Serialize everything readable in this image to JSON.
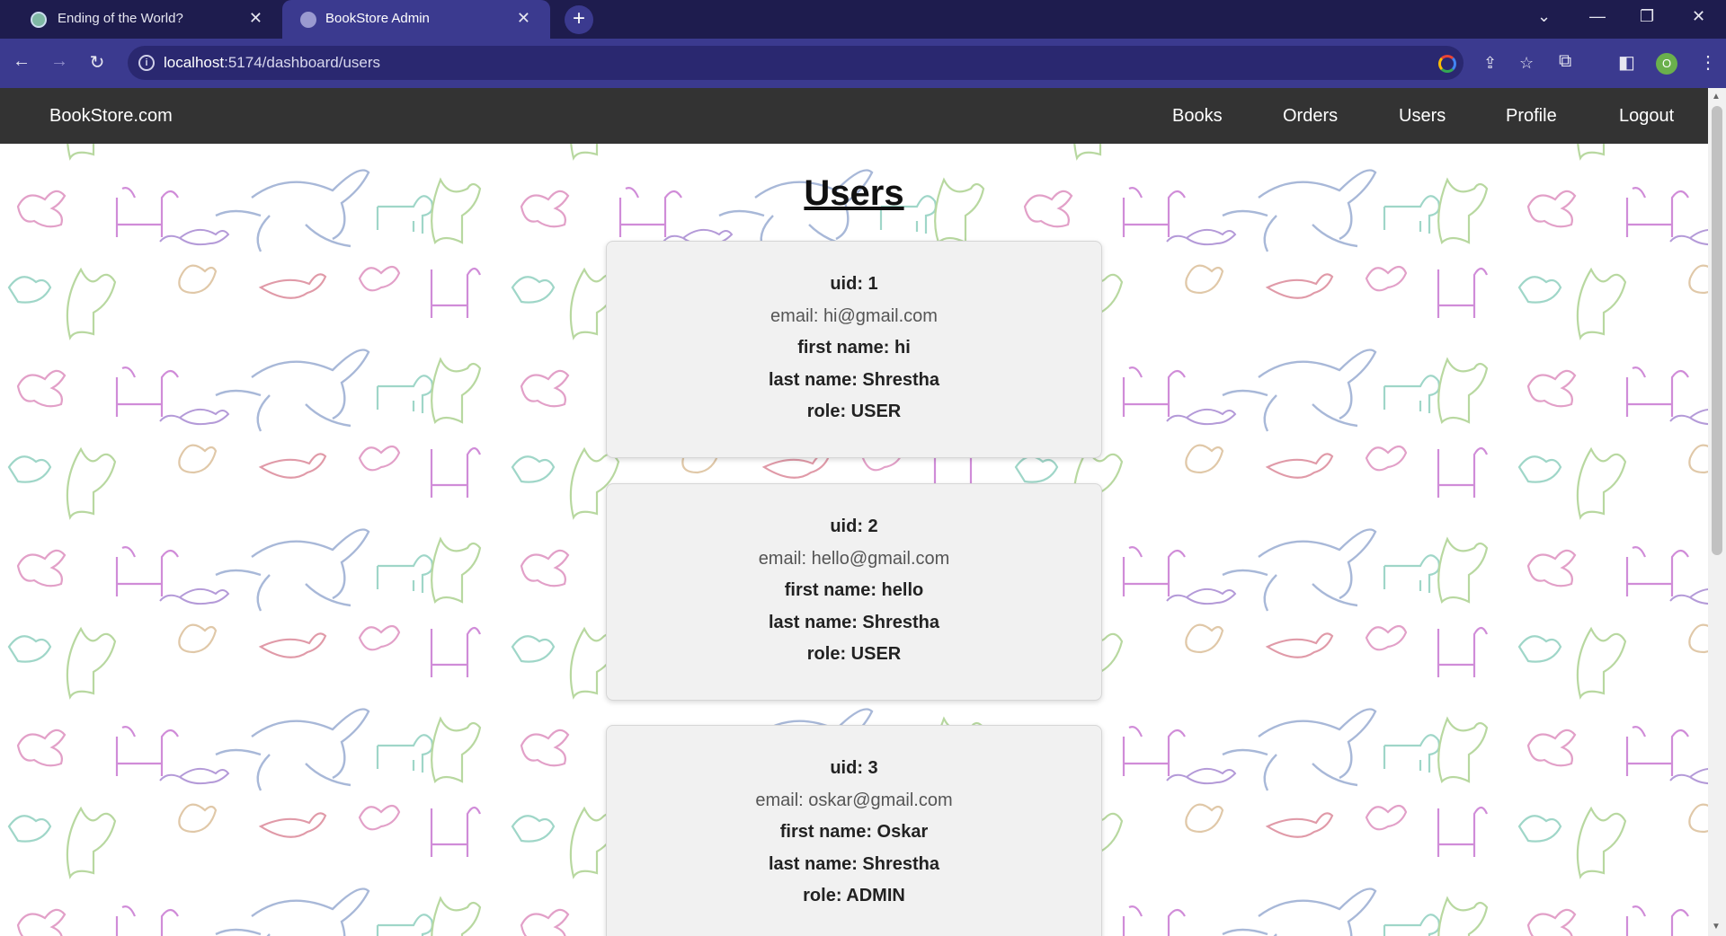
{
  "browser": {
    "tabs": [
      {
        "title": "Ending of the World?",
        "active": false,
        "icon": "chatgpt-icon"
      },
      {
        "title": "BookStore Admin",
        "active": true,
        "icon": "globe-icon"
      }
    ],
    "url_host": "localhost",
    "url_rest": ":5174/dashboard/users",
    "profile_initial": "O",
    "colors": {
      "tabbar": "#1e1c4e",
      "toolbar": "#3b3a8f"
    }
  },
  "navbar": {
    "brand": "BookStore.com",
    "links": [
      "Books",
      "Orders",
      "Users",
      "Profile",
      "Logout"
    ]
  },
  "page": {
    "title": "Users",
    "users": [
      {
        "uid": "uid: 1",
        "email": "email: hi@gmail.com",
        "first_name": "first name: hi",
        "last_name": "last name: Shrestha",
        "role": "role: USER"
      },
      {
        "uid": "uid: 2",
        "email": "email: hello@gmail.com",
        "first_name": "first name: hello",
        "last_name": "last name: Shrestha",
        "role": "role: USER"
      },
      {
        "uid": "uid: 3",
        "email": "email: oskar@gmail.com",
        "first_name": "first name: Oskar",
        "last_name": "last name: Shrestha",
        "role": "role: ADMIN"
      }
    ]
  }
}
